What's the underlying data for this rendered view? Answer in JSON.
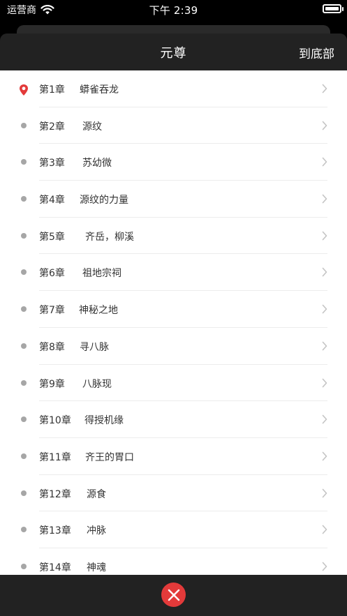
{
  "status_bar": {
    "carrier": "运营商",
    "time": "下午 2:39"
  },
  "header": {
    "title": "元尊",
    "to_bottom_label": "到底部"
  },
  "chapters": [
    {
      "no": "第1章",
      "title": "蟒雀吞龙",
      "current": true
    },
    {
      "no": "第2章",
      "title": "源纹",
      "current": false
    },
    {
      "no": "第3章",
      "title": "苏幼微",
      "current": false
    },
    {
      "no": "第4章",
      "title": "源纹的力量",
      "current": false
    },
    {
      "no": "第5章",
      "title": "齐岳，柳溪",
      "current": false
    },
    {
      "no": "第6章",
      "title": "祖地宗祠",
      "current": false
    },
    {
      "no": "第7章",
      "title": "神秘之地",
      "current": false
    },
    {
      "no": "第8章",
      "title": "寻八脉",
      "current": false
    },
    {
      "no": "第9章",
      "title": "八脉现",
      "current": false
    },
    {
      "no": "第10章",
      "title": "得授机缘",
      "current": false
    },
    {
      "no": "第11章",
      "title": "齐王的胃口",
      "current": false
    },
    {
      "no": "第12章",
      "title": "源食",
      "current": false
    },
    {
      "no": "第13章",
      "title": "冲脉",
      "current": false
    },
    {
      "no": "第14章",
      "title": "神魂",
      "current": false
    }
  ],
  "colors": {
    "accent": "#e33a3a",
    "header_bg": "#222222",
    "list_bg": "#ffffff",
    "dot": "#a6a6a6"
  },
  "icons": {
    "current_marker": "location-pin-icon",
    "row_marker": "dot-icon",
    "row_arrow": "chevron-right-icon",
    "close": "close-icon"
  }
}
